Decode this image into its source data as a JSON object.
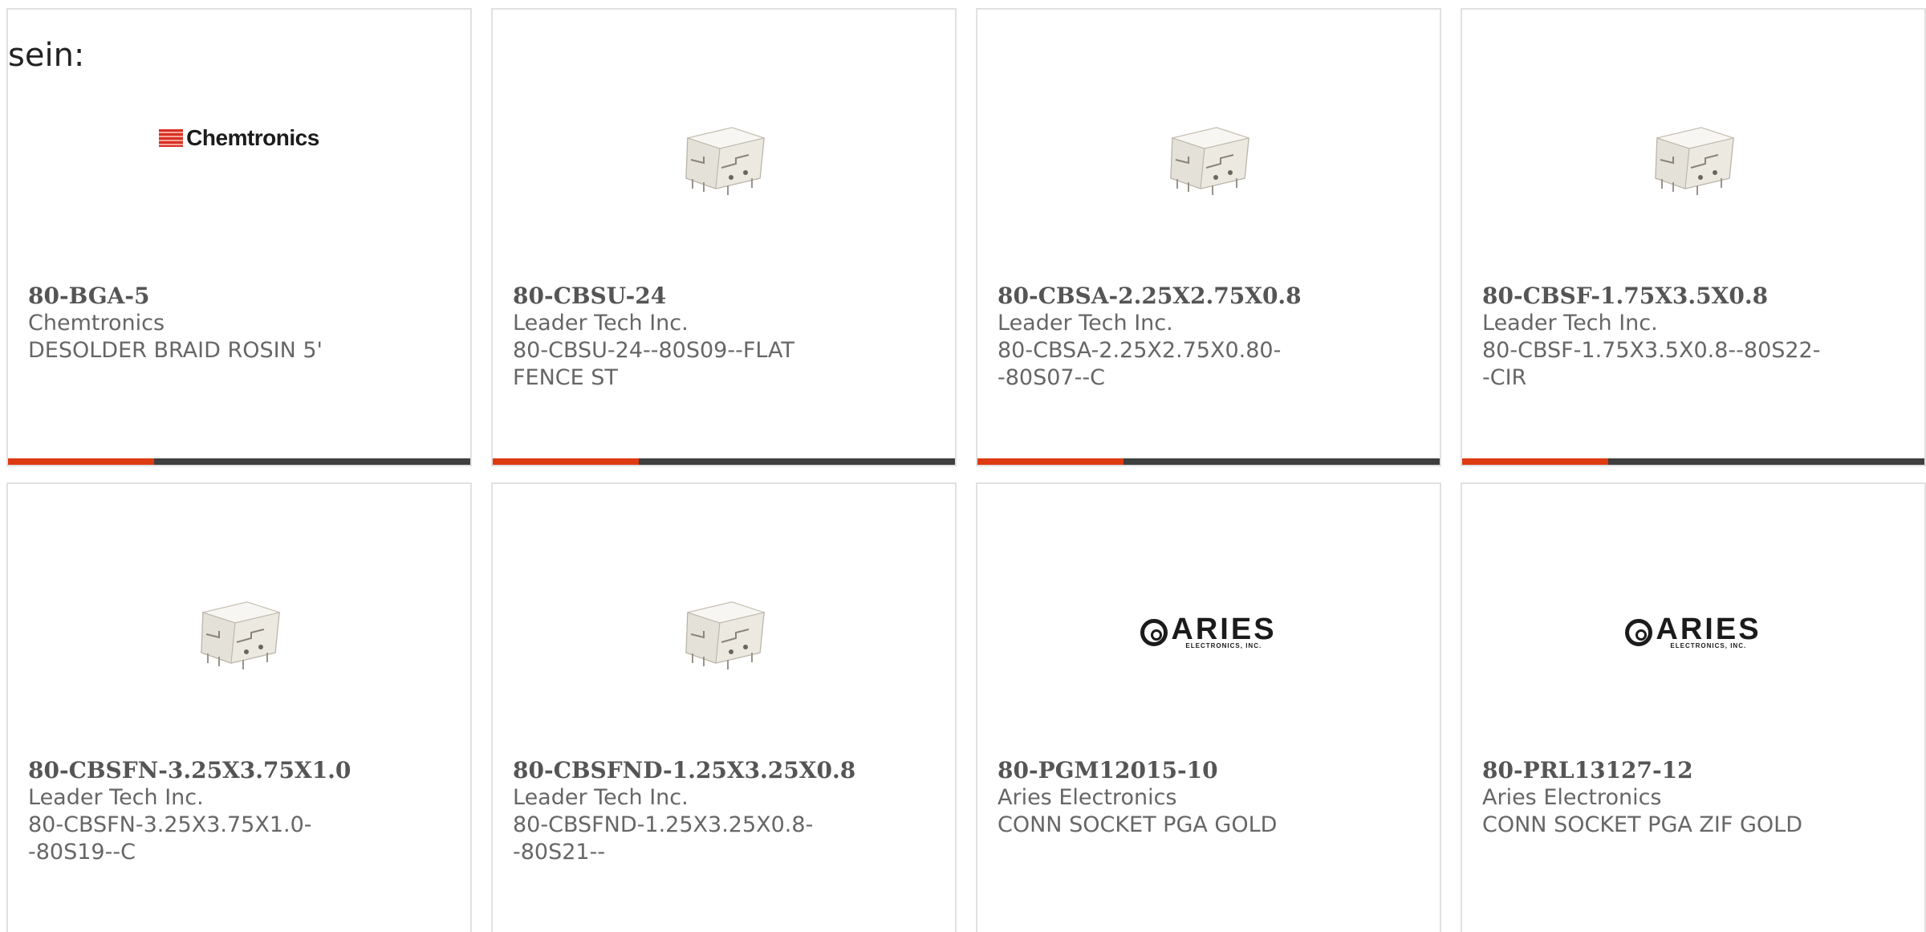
{
  "heading": "sein:",
  "products": [
    {
      "part_no": "80-BGA-5",
      "manufacturer": "Chemtronics",
      "description": "DESOLDER BRAID ROSIN 5'",
      "image": "chemtronics-logo",
      "logo_text": "Chemtronics"
    },
    {
      "part_no": "80-CBSU-24",
      "manufacturer": "Leader Tech Inc.",
      "description": "80-CBSU-24--80S09--FLAT FENCE ST",
      "image": "shield-can-photo"
    },
    {
      "part_no": "80-CBSA-2.25X2.75X0.8",
      "manufacturer": "Leader Tech Inc.",
      "description": "80-CBSA-2.25X2.75X0.80--80S07--C",
      "image": "shield-can-photo"
    },
    {
      "part_no": "80-CBSF-1.75X3.5X0.8",
      "manufacturer": "Leader Tech Inc.",
      "description": "80-CBSF-1.75X3.5X0.8--80S22--CIR",
      "image": "shield-can-photo"
    },
    {
      "part_no": "80-CBSFN-3.25X3.75X1.0",
      "manufacturer": "Leader Tech Inc.",
      "description": "80-CBSFN-3.25X3.75X1.0--80S19--C",
      "image": "shield-can-photo"
    },
    {
      "part_no": "80-CBSFND-1.25X3.25X0.8",
      "manufacturer": "Leader Tech Inc.",
      "description": "80-CBSFND-1.25X3.25X0.8--80S21--",
      "image": "shield-can-photo"
    },
    {
      "part_no": "80-PGM12015-10",
      "manufacturer": "Aries Electronics",
      "description": "CONN SOCKET PGA GOLD",
      "image": "aries-logo",
      "logo_text": "ARIES",
      "logo_sub": "ELECTRONICS, INC."
    },
    {
      "part_no": "80-PRL13127-12",
      "manufacturer": "Aries Electronics",
      "description": "CONN SOCKET PGA ZIF GOLD",
      "image": "aries-logo",
      "logo_text": "ARIES",
      "logo_sub": "ELECTRONICS, INC."
    }
  ],
  "colors": {
    "accent": "#de3a12",
    "bar": "#3f3f3f",
    "border": "#e1e1e1",
    "text": "#666666"
  }
}
